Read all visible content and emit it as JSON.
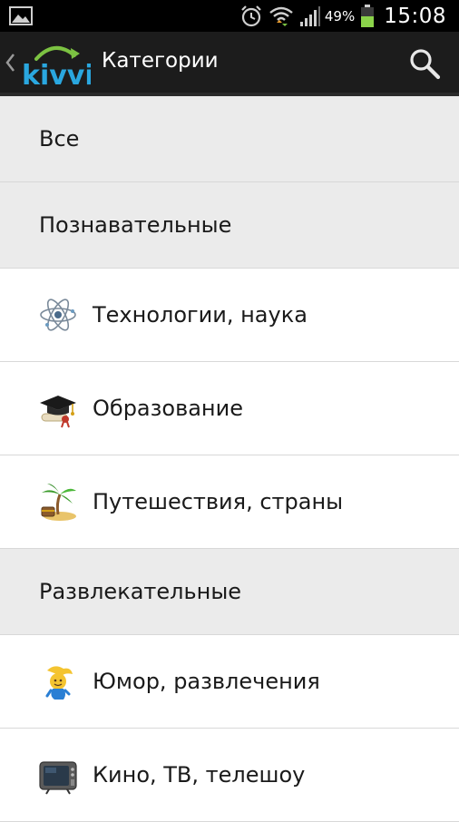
{
  "status_bar": {
    "battery_percent": "49%",
    "time": "15:08",
    "icons": [
      "gallery-icon",
      "alarm-icon",
      "wifi-icon",
      "signal-icon",
      "battery-icon"
    ]
  },
  "action_bar": {
    "logo_text": "kivvi",
    "title": "Категории",
    "icons": [
      "back-chevron-icon",
      "search-icon"
    ],
    "colors": {
      "background": "#1c1c1c",
      "logo_blue": "#2aa7df",
      "logo_green": "#7cc242"
    }
  },
  "categories": [
    {
      "label": "Все",
      "kind": "header"
    },
    {
      "label": "Познавательные",
      "kind": "header"
    },
    {
      "label": "Технологии, наука",
      "kind": "item",
      "icon": "atom-icon"
    },
    {
      "label": "Образование",
      "kind": "item",
      "icon": "graduation-cap-icon"
    },
    {
      "label": "Путешествия, страны",
      "kind": "item",
      "icon": "palm-island-icon"
    },
    {
      "label": "Развлекательные",
      "kind": "header"
    },
    {
      "label": "Юмор, развлечения",
      "kind": "item",
      "icon": "jester-icon"
    },
    {
      "label": "Кино, ТВ, телешоу",
      "kind": "item",
      "icon": "tv-icon"
    }
  ]
}
